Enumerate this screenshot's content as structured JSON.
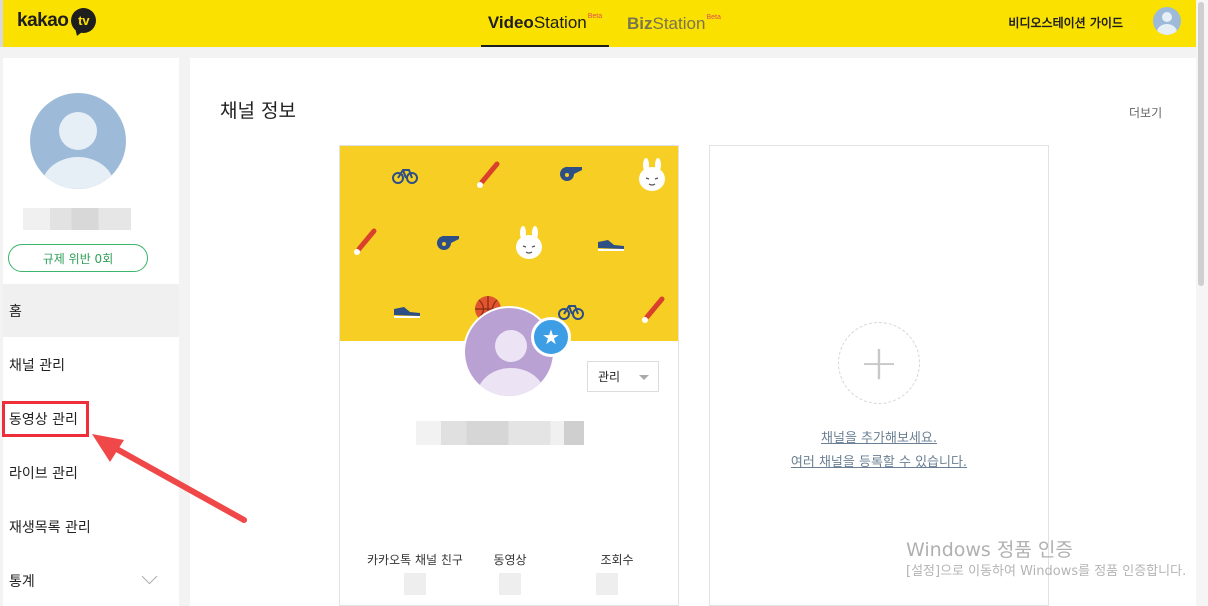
{
  "header": {
    "logo_text": "kakao",
    "logo_badge": "tv",
    "tabs": [
      {
        "label_strong": "Video",
        "label_rest": "Station",
        "badge": "Beta"
      },
      {
        "label_strong": "Biz",
        "label_rest": "Station",
        "badge": "Beta"
      }
    ],
    "guide_link": "비디오스테이션 가이드",
    "avatar_icon": "user-avatar-icon"
  },
  "sidebar": {
    "violation_button": "규제 위반 0회",
    "menu": [
      {
        "label": "홈",
        "active": true
      },
      {
        "label": "채널 관리",
        "active": false
      },
      {
        "label": "동영상 관리",
        "active": false
      },
      {
        "label": "라이브 관리",
        "active": false
      },
      {
        "label": "재생목록 관리",
        "active": false
      },
      {
        "label": "통계",
        "active": false
      }
    ]
  },
  "main": {
    "section_title": "채널 정보",
    "more_link": "더보기",
    "channel_card": {
      "manage_select": "관리",
      "stats": [
        {
          "label": "카카오톡 채널 친구"
        },
        {
          "label": "동영상"
        },
        {
          "label": "조회수"
        }
      ]
    },
    "add_card": {
      "plus_symbol": "+",
      "line1": "채널을 추가해보세요.",
      "line2": "여러 채널을 등록할 수 있습니다."
    }
  },
  "watermark": {
    "title": "Windows 정품 인증",
    "subtitle": "[설정]으로 이동하여 Windows를 정품 인증합니다."
  },
  "colors": {
    "header_bg": "#fae100",
    "cover_bg": "#f7cf24",
    "violation_green": "#3db46b",
    "highlight_red": "#ee2e3a",
    "star_blue": "#3d9ee6"
  }
}
